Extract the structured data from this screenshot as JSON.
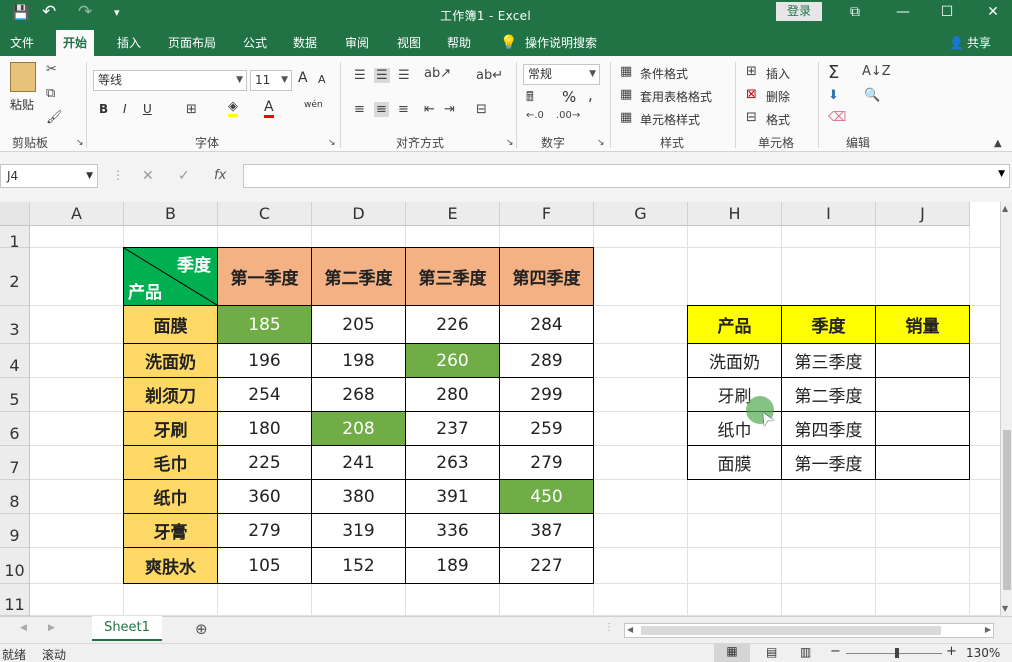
{
  "window": {
    "title": "工作簿1  -  Excel",
    "login_label": "登录",
    "minimize": "—",
    "restore": "☐",
    "close": "✕",
    "ribbon_display": "⧉"
  },
  "quick_access": {
    "save_icon": "💾",
    "undo_icon": "↶",
    "redo_icon": "↷",
    "customize_icon": "▾"
  },
  "tabs": [
    "文件",
    "开始",
    "插入",
    "页面布局",
    "公式",
    "数据",
    "审阅",
    "视图",
    "帮助"
  ],
  "active_tab": "开始",
  "tell_me": "操作说明搜索",
  "share": "共享",
  "ribbon": {
    "clipboard": {
      "label": "剪贴板",
      "paste": "粘贴"
    },
    "font": {
      "label": "字体",
      "name": "等线",
      "size": "11",
      "bold": "B",
      "italic": "I",
      "underline": "U",
      "grow": "A",
      "shrink": "A",
      "wen": "wén"
    },
    "alignment": {
      "label": "对齐方式"
    },
    "number": {
      "label": "数字",
      "format": "常规",
      "percent": "%",
      "comma": ","
    },
    "styles": {
      "label": "样式",
      "conditional": "条件格式",
      "table": "套用表格格式",
      "cell": "单元格样式"
    },
    "cells": {
      "label": "单元格",
      "insert": "插入",
      "delete": "删除",
      "format": "格式"
    },
    "editing": {
      "label": "编辑",
      "sum": "Σ"
    }
  },
  "formula_bar": {
    "name_box": "J4",
    "cancel": "✕",
    "enter": "✓",
    "fx": "fx",
    "value": ""
  },
  "columns": [
    "A",
    "B",
    "C",
    "D",
    "E",
    "F",
    "G",
    "H",
    "I",
    "J"
  ],
  "rows": [
    "1",
    "2",
    "3",
    "4",
    "5",
    "6",
    "7",
    "8",
    "9",
    "10",
    "11"
  ],
  "table1": {
    "corner_top": "季度",
    "corner_bottom": "产品",
    "headers": [
      "第一季度",
      "第二季度",
      "第三季度",
      "第四季度"
    ],
    "rows": [
      {
        "product": "面膜",
        "values": [
          "185",
          "205",
          "226",
          "284"
        ]
      },
      {
        "product": "洗面奶",
        "values": [
          "196",
          "198",
          "260",
          "289"
        ]
      },
      {
        "product": "剃须刀",
        "values": [
          "254",
          "268",
          "280",
          "299"
        ]
      },
      {
        "product": "牙刷",
        "values": [
          "180",
          "208",
          "237",
          "259"
        ]
      },
      {
        "product": "毛巾",
        "values": [
          "225",
          "241",
          "263",
          "279"
        ]
      },
      {
        "product": "纸巾",
        "values": [
          "360",
          "380",
          "391",
          "450"
        ]
      },
      {
        "product": "牙膏",
        "values": [
          "279",
          "319",
          "336",
          "387"
        ]
      },
      {
        "product": "爽肤水",
        "values": [
          "105",
          "152",
          "189",
          "227"
        ]
      }
    ],
    "highlight_color": "#70ad47",
    "header_color": "#f4b183",
    "product_color": "#ffd966"
  },
  "table2": {
    "headers": [
      "产品",
      "季度",
      "销量"
    ],
    "rows": [
      {
        "product": "洗面奶",
        "quarter": "第三季度",
        "sales": ""
      },
      {
        "product": "牙刷",
        "quarter": "第二季度",
        "sales": ""
      },
      {
        "product": "纸巾",
        "quarter": "第四季度",
        "sales": ""
      },
      {
        "product": "面膜",
        "quarter": "第一季度",
        "sales": ""
      }
    ],
    "header_color": "#ffff00"
  },
  "sheet_tab": "Sheet1",
  "status": {
    "ready": "就绪",
    "scroll": "滚动",
    "zoom": "130%"
  },
  "accent": "#217346"
}
